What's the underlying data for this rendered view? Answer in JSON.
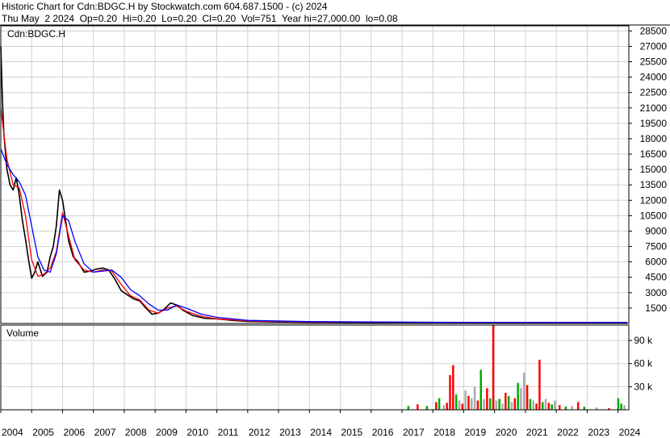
{
  "header": {
    "line1": "Historic Chart for Cdn:BDGC.H by Stockwatch.com 604.687.1500 - (c) 2024",
    "line2": "Thu May  2 2024  Op=0.20  Hi=0.20  Lo=0.20  Cl=0.20  Vol=751  Year hi=27,000.00  lo=0.08"
  },
  "chart_data": [
    {
      "type": "line",
      "panel": "price",
      "title": "Cdn:BDGC.H",
      "ylim": [
        0,
        29000
      ],
      "y_ticks": [
        1500,
        3000,
        4500,
        6000,
        7500,
        9000,
        10500,
        12000,
        13500,
        15000,
        16500,
        18000,
        19500,
        21000,
        22500,
        24000,
        25500,
        27000,
        28500
      ],
      "x_range": [
        2004.0,
        2024.35
      ],
      "x_tick_labels": [
        "2004",
        "2005",
        "2006",
        "2007",
        "2008",
        "2009",
        "2010",
        "2011",
        "2012",
        "2013",
        "2014",
        "2015",
        "2016",
        "2017",
        "2018",
        "2019",
        "2020",
        "2021",
        "2022",
        "2023",
        "2024"
      ],
      "grid": true,
      "series": [
        {
          "color": "#000000",
          "x": [
            2004.0,
            2004.05,
            2004.1,
            2004.2,
            2004.3,
            2004.4,
            2004.5,
            2004.6,
            2004.7,
            2004.8,
            2004.9,
            2005.0,
            2005.1,
            2005.2,
            2005.35,
            2005.5,
            2005.6,
            2005.7,
            2005.8,
            2005.9,
            2006.0,
            2006.1,
            2006.2,
            2006.35,
            2006.5,
            2006.7,
            2006.9,
            2007.1,
            2007.3,
            2007.5,
            2007.7,
            2007.9,
            2008.1,
            2008.3,
            2008.5,
            2008.7,
            2008.9,
            2009.1,
            2009.3,
            2009.5,
            2009.7,
            2009.9,
            2010.2,
            2010.6,
            2011.0,
            2011.5,
            2012.0,
            2013.0,
            2014.0,
            2016.0,
            2018.0,
            2020.0,
            2022.0,
            2024.3
          ],
          "y": [
            27000,
            22000,
            18500,
            15000,
            13500,
            13000,
            14200,
            12500,
            10000,
            8200,
            6200,
            4400,
            5000,
            6000,
            4600,
            5000,
            6500,
            7500,
            9500,
            13000,
            12000,
            10000,
            8000,
            6500,
            6000,
            5000,
            5100,
            5300,
            5400,
            5200,
            4300,
            3200,
            2800,
            2400,
            2200,
            1500,
            900,
            1000,
            1400,
            2000,
            1800,
            1300,
            800,
            500,
            450,
            300,
            200,
            150,
            120,
            100,
            100,
            90,
            90,
            80
          ]
        },
        {
          "color": "#ff0000",
          "x": [
            2004.0,
            2004.2,
            2004.4,
            2004.6,
            2004.8,
            2005.0,
            2005.2,
            2005.4,
            2005.6,
            2005.8,
            2006.0,
            2006.2,
            2006.4,
            2006.7,
            2007.0,
            2007.3,
            2007.6,
            2007.9,
            2008.2,
            2008.5,
            2008.8,
            2009.1,
            2009.4,
            2009.7,
            2010.0,
            2010.5,
            2011.0,
            2012.0,
            2014.0,
            2018.0,
            2024.3
          ],
          "y": [
            21000,
            16000,
            13500,
            13200,
            10500,
            6200,
            4600,
            4800,
            5400,
            7000,
            10800,
            8500,
            6200,
            5200,
            5000,
            5200,
            5100,
            3800,
            2700,
            2300,
            1300,
            1000,
            1500,
            1700,
            1200,
            700,
            450,
            250,
            150,
            100,
            90
          ]
        },
        {
          "color": "#0000ff",
          "x": [
            2004.0,
            2004.2,
            2004.4,
            2004.6,
            2004.8,
            2005.0,
            2005.2,
            2005.4,
            2005.6,
            2005.8,
            2006.0,
            2006.2,
            2006.4,
            2006.7,
            2007.0,
            2007.3,
            2007.6,
            2007.9,
            2008.2,
            2008.5,
            2008.8,
            2009.1,
            2009.4,
            2009.7,
            2010.0,
            2010.5,
            2011.0,
            2012.0,
            2014.0,
            2018.0,
            2024.3
          ],
          "y": [
            17000,
            15500,
            14500,
            13800,
            12500,
            9500,
            6500,
            5200,
            5000,
            6800,
            10500,
            10000,
            8000,
            5800,
            5000,
            5100,
            5200,
            4500,
            3300,
            2700,
            1900,
            1300,
            1300,
            1800,
            1500,
            900,
            600,
            300,
            180,
            110,
            90
          ]
        }
      ]
    },
    {
      "type": "bar",
      "panel": "volume",
      "title": "Volume",
      "ylim": [
        0,
        110000
      ],
      "y_ticks": [
        30000,
        60000,
        90000
      ],
      "y_tick_labels": [
        "30 k",
        "60 k",
        "90 k"
      ],
      "x_range": [
        2004.0,
        2024.35
      ],
      "grid": true,
      "series": [
        {
          "x": [
            2017.2,
            2017.5,
            2017.8,
            2018.1,
            2018.2,
            2018.35,
            2018.45,
            2018.55,
            2018.65,
            2018.75,
            2018.85,
            2018.95,
            2019.05,
            2019.15,
            2019.25,
            2019.35,
            2019.45,
            2019.55,
            2019.65,
            2019.75,
            2019.85,
            2019.95,
            2020.05,
            2020.15,
            2020.25,
            2020.35,
            2020.45,
            2020.55,
            2020.65,
            2020.75,
            2020.85,
            2020.95,
            2021.05,
            2021.15,
            2021.25,
            2021.35,
            2021.45,
            2021.55,
            2021.65,
            2021.75,
            2021.85,
            2021.95,
            2022.1,
            2022.3,
            2022.5,
            2022.7,
            2022.9,
            2023.3,
            2023.7,
            2024.0,
            2024.1,
            2024.2
          ],
          "y": [
            5000,
            7000,
            5000,
            10000,
            15000,
            6000,
            9000,
            45000,
            58000,
            20000,
            12000,
            8000,
            25000,
            18000,
            15000,
            30000,
            12000,
            52000,
            14000,
            28000,
            15000,
            110000,
            12000,
            14000,
            8000,
            22000,
            18000,
            10000,
            15000,
            35000,
            28000,
            48000,
            32000,
            14000,
            12000,
            8000,
            65000,
            10000,
            14000,
            9000,
            7000,
            12000,
            6000,
            4000,
            5000,
            10000,
            4000,
            3000,
            2000,
            15000,
            8000,
            6000
          ],
          "colors": [
            "#00aa00",
            "#ff0000",
            "#00aa00",
            "#ff0000",
            "#00aa00",
            "#aaaaaa",
            "#ff0000",
            "#ff0000",
            "#ff0000",
            "#00aa00",
            "#aaaaaa",
            "#ff0000",
            "#aaaaaa",
            "#ff0000",
            "#aaaaaa",
            "#aaaaaa",
            "#ff0000",
            "#00aa00",
            "#aaaaaa",
            "#ff0000",
            "#00aa00",
            "#ff0000",
            "#aaaaaa",
            "#00aa00",
            "#aaaaaa",
            "#ff0000",
            "#00aa00",
            "#aaaaaa",
            "#ff0000",
            "#00aa00",
            "#aaaaaa",
            "#aaaaaa",
            "#ff0000",
            "#00aa00",
            "#aaaaaa",
            "#ff0000",
            "#ff0000",
            "#00aa00",
            "#aaaaaa",
            "#ff0000",
            "#00aa00",
            "#aaaaaa",
            "#ff0000",
            "#00aa00",
            "#aaaaaa",
            "#ff0000",
            "#00aa00",
            "#aaaaaa",
            "#ff0000",
            "#00aa00",
            "#00aa00",
            "#aaaaaa"
          ]
        }
      ]
    }
  ]
}
